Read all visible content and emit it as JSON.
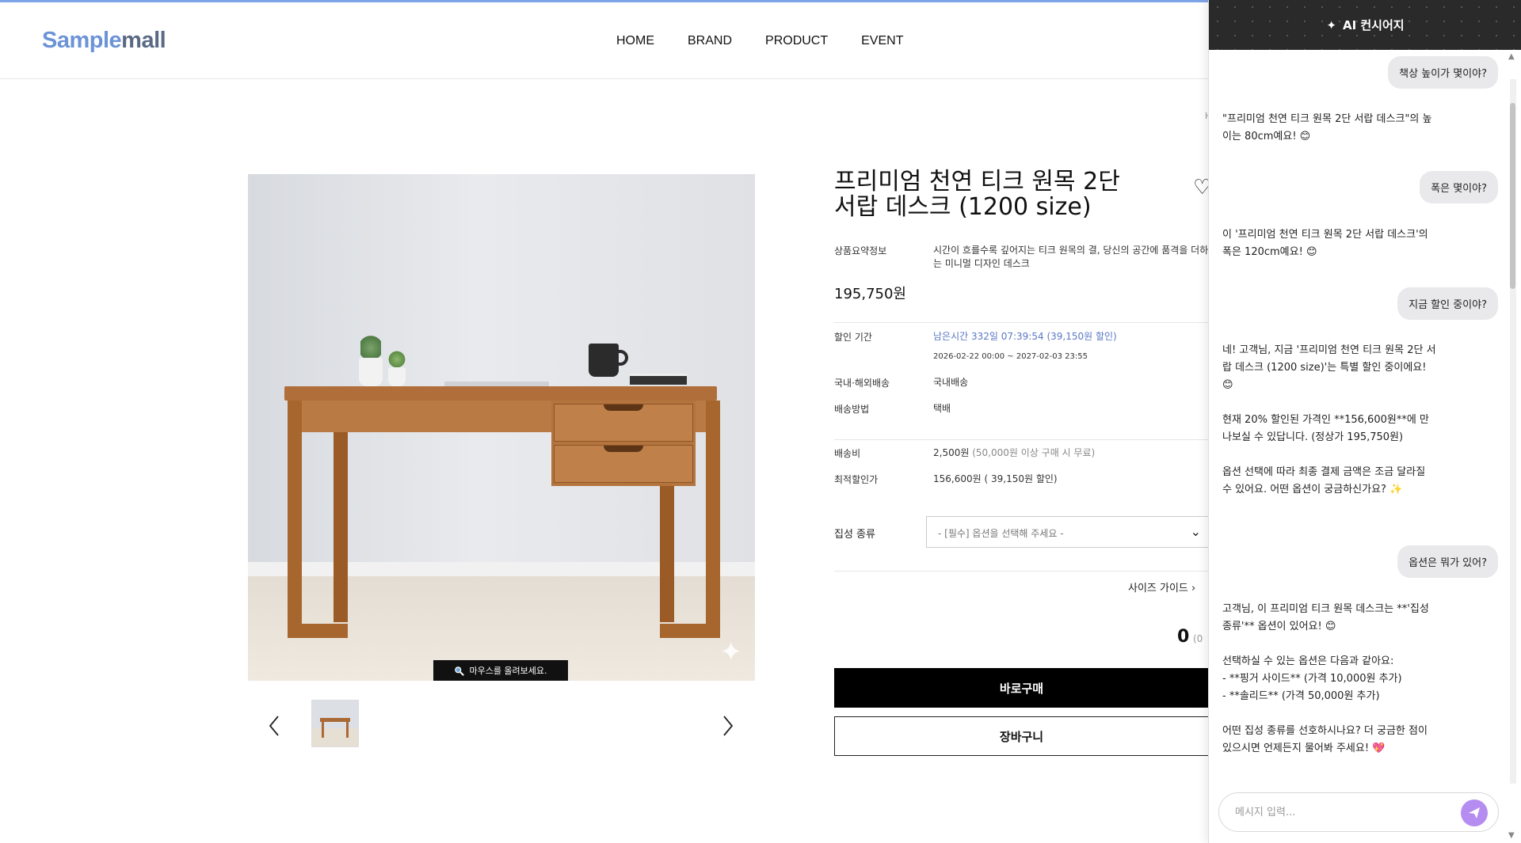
{
  "header": {
    "logo_part1": "Sample",
    "logo_part2": "mall",
    "nav": [
      "HOME",
      "BRAND",
      "PRODUCT",
      "EVENT"
    ]
  },
  "gallery": {
    "zoom_hint": "마우스를 올려보세요.",
    "zoom_icon": "magnifier-icon",
    "prev_icon": "chevron-left-icon",
    "next_icon": "chevron-right-icon"
  },
  "breadcrumb_glimpse": "H",
  "product": {
    "title": "프리미엄 천연 티크 원목 2단 서랍 데스크 (1200 size)",
    "summary_label": "상품요약정보",
    "summary": "시간이 흐를수록 깊어지는 티크 원목의 결, 당신의 공간에 품격을 더하는 미니멀 디자인 데스크",
    "price": "195,750원",
    "discount_label": "할인 기간",
    "discount_remaining": "남은시간 332일 07:39:54 (39,150원 할인)",
    "discount_period": "2026-02-22 00:00 ~ 2027-02-03 23:55",
    "ship_type_label": "국내·해외배송",
    "ship_type": "국내배송",
    "ship_method_label": "배송방법",
    "ship_method": "택배",
    "ship_fee_label": "배송비",
    "ship_fee": "2,500원",
    "ship_fee_note": "(50,000원 이상 구매 시 무료)",
    "best_price_label": "최적할인가",
    "best_price": "156,600원",
    "best_price_note": "( 39,150원 할인)",
    "option_label": "집성 종류",
    "option_placeholder": "- [필수] 옵션을 선택해 주세요 -",
    "size_guide": "사이즈 가이드",
    "qty_total": "0",
    "qty_total_sub": "(0",
    "buy_now": "바로구매",
    "cart": "장바구니"
  },
  "chat": {
    "title": "AI 컨시어지",
    "messages": [
      {
        "role": "user",
        "text": "책상 높이가 몇이야?"
      },
      {
        "role": "bot",
        "text": "\"프리미엄 천연 티크 원목 2단 서랍 데스크\"의 높이는 80cm예요! 😊"
      },
      {
        "role": "user",
        "text": "폭은 몇이야?"
      },
      {
        "role": "bot",
        "text": "이 '프리미엄 천연 티크 원목 2단 서랍 데스크'의 폭은 120cm예요! 😊"
      },
      {
        "role": "user",
        "text": "지금 할인 중이야?"
      },
      {
        "role": "bot",
        "text": "네! 고객님, 지금 '프리미엄 천연 티크 원목 2단 서랍 데스크 (1200 size)'는 특별 할인 중이에요! 😊\n\n현재 20% 할인된 가격인 **156,600원**에 만나보실 수 있답니다. (정상가 195,750원)\n\n옵션 선택에 따라 최종 결제 금액은 조금 달라질 수 있어요. 어떤 옵션이 궁금하신가요? ✨"
      },
      {
        "role": "user",
        "text": "옵션은 뭐가 있어?"
      },
      {
        "role": "bot",
        "text": "고객님, 이 프리미엄 티크 원목 데스크는 **'집성 종류'** 옵션이 있어요! 😊\n\n선택하실 수 있는 옵션은 다음과 같아요:\n- **핑거 사이드** (가격 10,000원 추가)\n- **솔리드** (가격 50,000원 추가)\n\n어떤 집성 종류를 선호하시나요? 더 궁금한 점이 있으시면 언제든지 물어봐 주세요! 💖"
      }
    ],
    "input_placeholder": "메시지 입력...",
    "send_icon": "send-icon"
  }
}
